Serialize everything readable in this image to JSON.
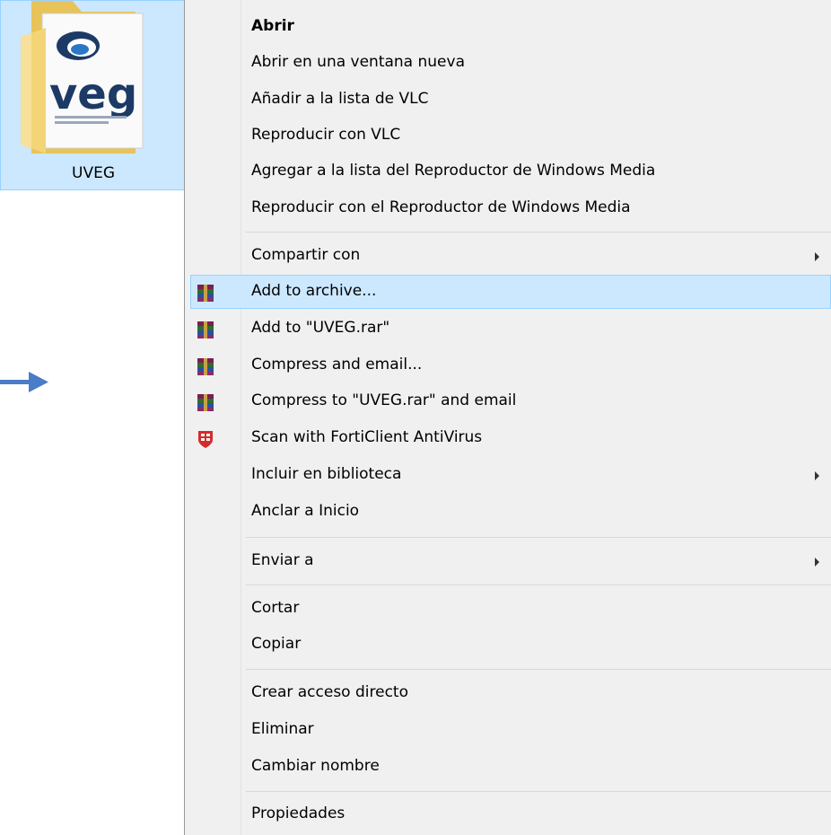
{
  "desktop": {
    "folder_label": "UVEG",
    "logo_text": "veg"
  },
  "menu": {
    "items": [
      {
        "label": "Abrir"
      },
      {
        "label": "Abrir en una ventana nueva"
      },
      {
        "label": "Añadir a la lista de VLC"
      },
      {
        "label": "Reproducir con VLC"
      },
      {
        "label": "Agregar a la lista del Reproductor de Windows Media"
      },
      {
        "label": "Reproducir con el Reproductor de Windows Media"
      },
      {
        "label": "Compartir con"
      },
      {
        "label": "Add to archive..."
      },
      {
        "label": "Add to \"UVEG.rar\""
      },
      {
        "label": "Compress and email..."
      },
      {
        "label": "Compress to \"UVEG.rar\" and email"
      },
      {
        "label": "Scan with FortiClient AntiVirus"
      },
      {
        "label": "Incluir en biblioteca"
      },
      {
        "label": "Anclar a Inicio"
      },
      {
        "label": "Enviar a"
      },
      {
        "label": "Cortar"
      },
      {
        "label": "Copiar"
      },
      {
        "label": "Crear acceso directo"
      },
      {
        "label": "Eliminar"
      },
      {
        "label": "Cambiar nombre"
      },
      {
        "label": "Propiedades"
      }
    ],
    "highlighted": "Add to archive...",
    "icons": {
      "winrar": "winrar-icon",
      "forticlient": "forticlient-icon",
      "submenu": "chevron-right-icon",
      "arrow": "arrow-right-icon"
    }
  },
  "colors": {
    "highlight_bg": "#cce8ff",
    "highlight_border": "#99d1ff",
    "menu_bg": "#f0f0f0",
    "arrow": "#4a7cc7"
  }
}
